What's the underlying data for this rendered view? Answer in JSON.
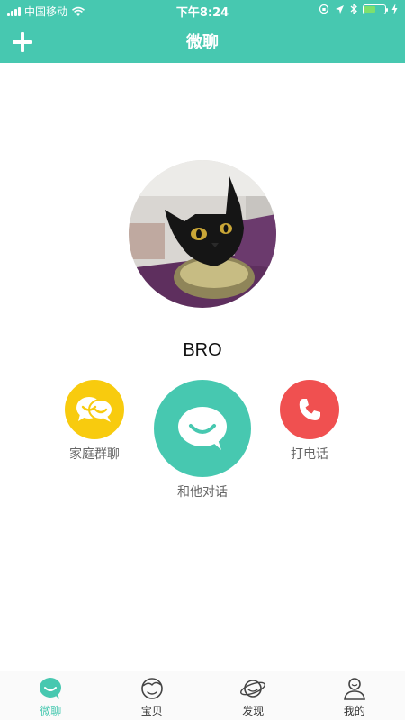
{
  "status_bar": {
    "carrier": "中国移动",
    "time": "下午8:24"
  },
  "nav": {
    "title": "微聊",
    "add_icon": "plus-icon"
  },
  "profile": {
    "name": "BRO",
    "avatar": "black cat photo"
  },
  "actions": {
    "family_chat": {
      "label": "家庭群聊",
      "icon": "double-chat-bubble-icon",
      "color": "#f8cb0e"
    },
    "talk": {
      "label": "和他对话",
      "icon": "smile-chat-bubble-icon",
      "color": "#47c8b0"
    },
    "call": {
      "label": "打电话",
      "icon": "phone-icon",
      "color": "#f05050"
    }
  },
  "tabs": [
    {
      "label": "微聊",
      "icon": "chat-bubble-icon",
      "active": true
    },
    {
      "label": "宝贝",
      "icon": "baby-face-icon",
      "active": false
    },
    {
      "label": "发现",
      "icon": "planet-icon",
      "active": false
    },
    {
      "label": "我的",
      "icon": "person-icon",
      "active": false
    }
  ],
  "colors": {
    "accent": "#47c8b0"
  }
}
